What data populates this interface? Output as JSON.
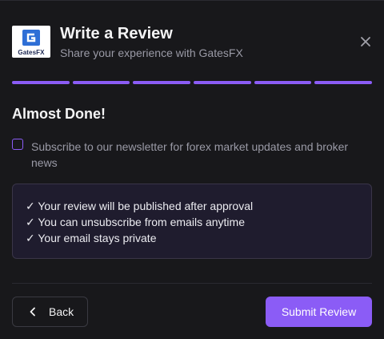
{
  "header": {
    "logo_text": "GatesFX",
    "title": "Write a Review",
    "subtitle": "Share your experience with GatesFX",
    "close_icon": "close-icon"
  },
  "progress": {
    "total_steps": 6,
    "completed_steps": 6,
    "color": "#8b5cf6"
  },
  "step": {
    "heading": "Almost Done!",
    "newsletter_checked": false,
    "newsletter_label": "Subscribe to our newsletter for forex market updates and broker news",
    "info_items": [
      "✓ Your review will be published after approval",
      "✓ You can unsubscribe from emails anytime",
      "✓ Your email stays private"
    ]
  },
  "footer": {
    "back_label": "Back",
    "submit_label": "Submit Review"
  },
  "colors": {
    "accent": "#8b5cf6",
    "background": "#18181b"
  }
}
